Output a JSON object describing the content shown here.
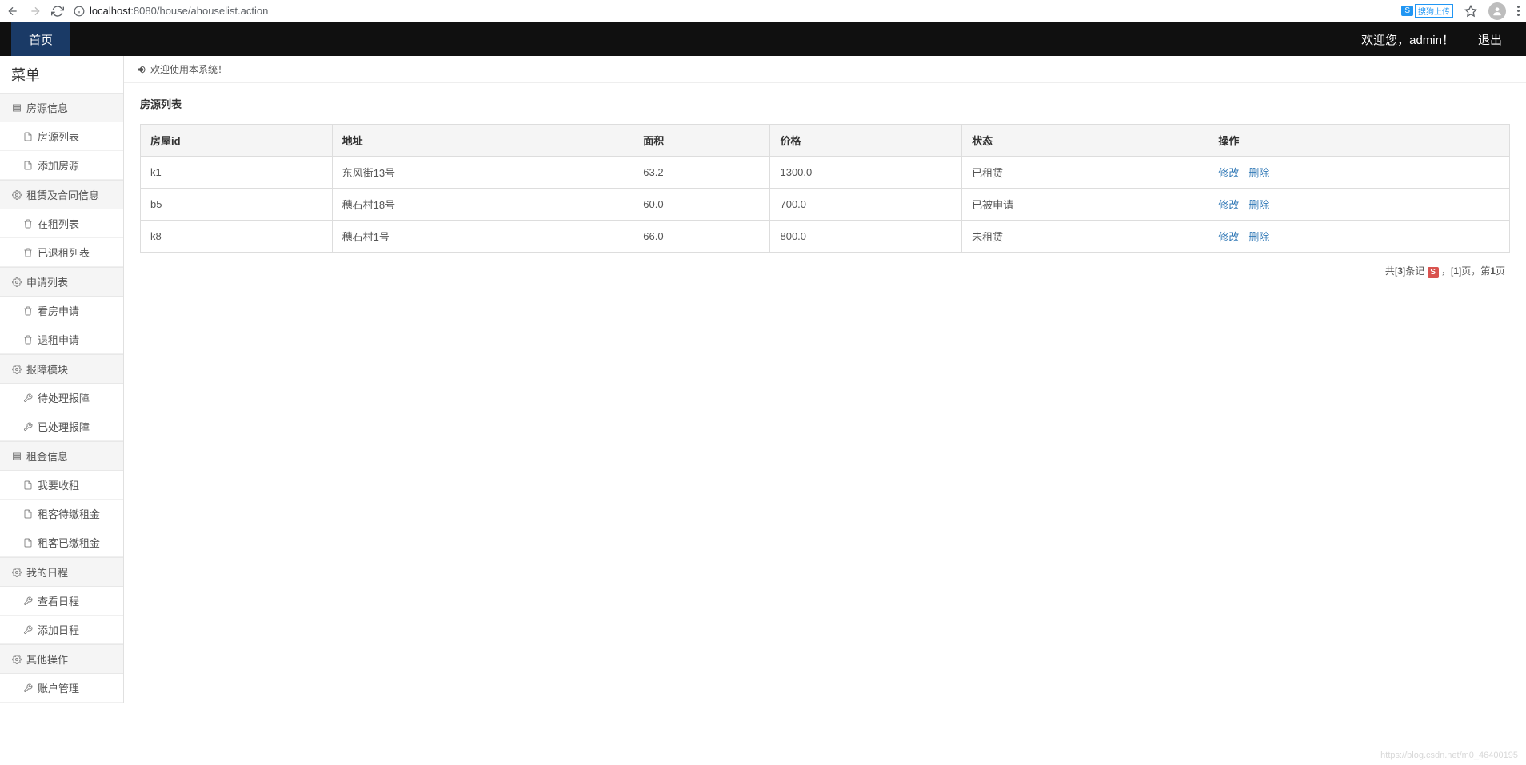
{
  "browser": {
    "url_host": "localhost",
    "url_port": ":8080",
    "url_path": "/house/ahouselist.action",
    "ext_badge": "S",
    "ext_label": "搜狗上传"
  },
  "header": {
    "home": "首页",
    "welcome": "欢迎您，admin！",
    "logout": "退出"
  },
  "sidebar": {
    "title": "菜单",
    "groups": [
      {
        "label": "房源信息",
        "icon": "list",
        "items": [
          {
            "label": "房源列表",
            "icon": "file"
          },
          {
            "label": "添加房源",
            "icon": "file"
          }
        ]
      },
      {
        "label": "租赁及合同信息",
        "icon": "gear",
        "items": [
          {
            "label": "在租列表",
            "icon": "trash"
          },
          {
            "label": "已退租列表",
            "icon": "trash"
          }
        ]
      },
      {
        "label": "申请列表",
        "icon": "gear",
        "items": [
          {
            "label": "看房申请",
            "icon": "trash"
          },
          {
            "label": "退租申请",
            "icon": "trash"
          }
        ]
      },
      {
        "label": "报障模块",
        "icon": "gear",
        "items": [
          {
            "label": "待处理报障",
            "icon": "wrench"
          },
          {
            "label": "已处理报障",
            "icon": "wrench"
          }
        ]
      },
      {
        "label": "租金信息",
        "icon": "list",
        "items": [
          {
            "label": "我要收租",
            "icon": "file"
          },
          {
            "label": "租客待缴租金",
            "icon": "file"
          },
          {
            "label": "租客已缴租金",
            "icon": "file"
          }
        ]
      },
      {
        "label": "我的日程",
        "icon": "gear",
        "items": [
          {
            "label": "查看日程",
            "icon": "wrench"
          },
          {
            "label": "添加日程",
            "icon": "wrench"
          }
        ]
      },
      {
        "label": "其他操作",
        "icon": "gear",
        "items": [
          {
            "label": "账户管理",
            "icon": "wrench"
          }
        ]
      }
    ]
  },
  "content": {
    "welcome_msg": "欢迎使用本系统！",
    "panel_title": "房源列表"
  },
  "table": {
    "headers": [
      "房屋id",
      "地址",
      "面积",
      "价格",
      "状态",
      "操作"
    ],
    "rows": [
      {
        "id": "k1",
        "address": "东风街13号",
        "area": "63.2",
        "price": "1300.0",
        "status": "已租赁"
      },
      {
        "id": "b5",
        "address": "穗石村18号",
        "area": "60.0",
        "price": "700.0",
        "status": "已被申请"
      },
      {
        "id": "k8",
        "address": "穗石村1号",
        "area": "66.0",
        "price": "800.0",
        "status": "未租赁"
      }
    ],
    "action_edit": "修改",
    "action_delete": "删除"
  },
  "pagination": {
    "text_pre": "共[",
    "total": "3",
    "text_mid1": "]条记",
    "badge": "S",
    "text_mid2": "，[",
    "pages": "1",
    "text_mid3": "]页，第",
    "current": "1",
    "text_end": "页"
  },
  "watermark": "https://blog.csdn.net/m0_46400195"
}
